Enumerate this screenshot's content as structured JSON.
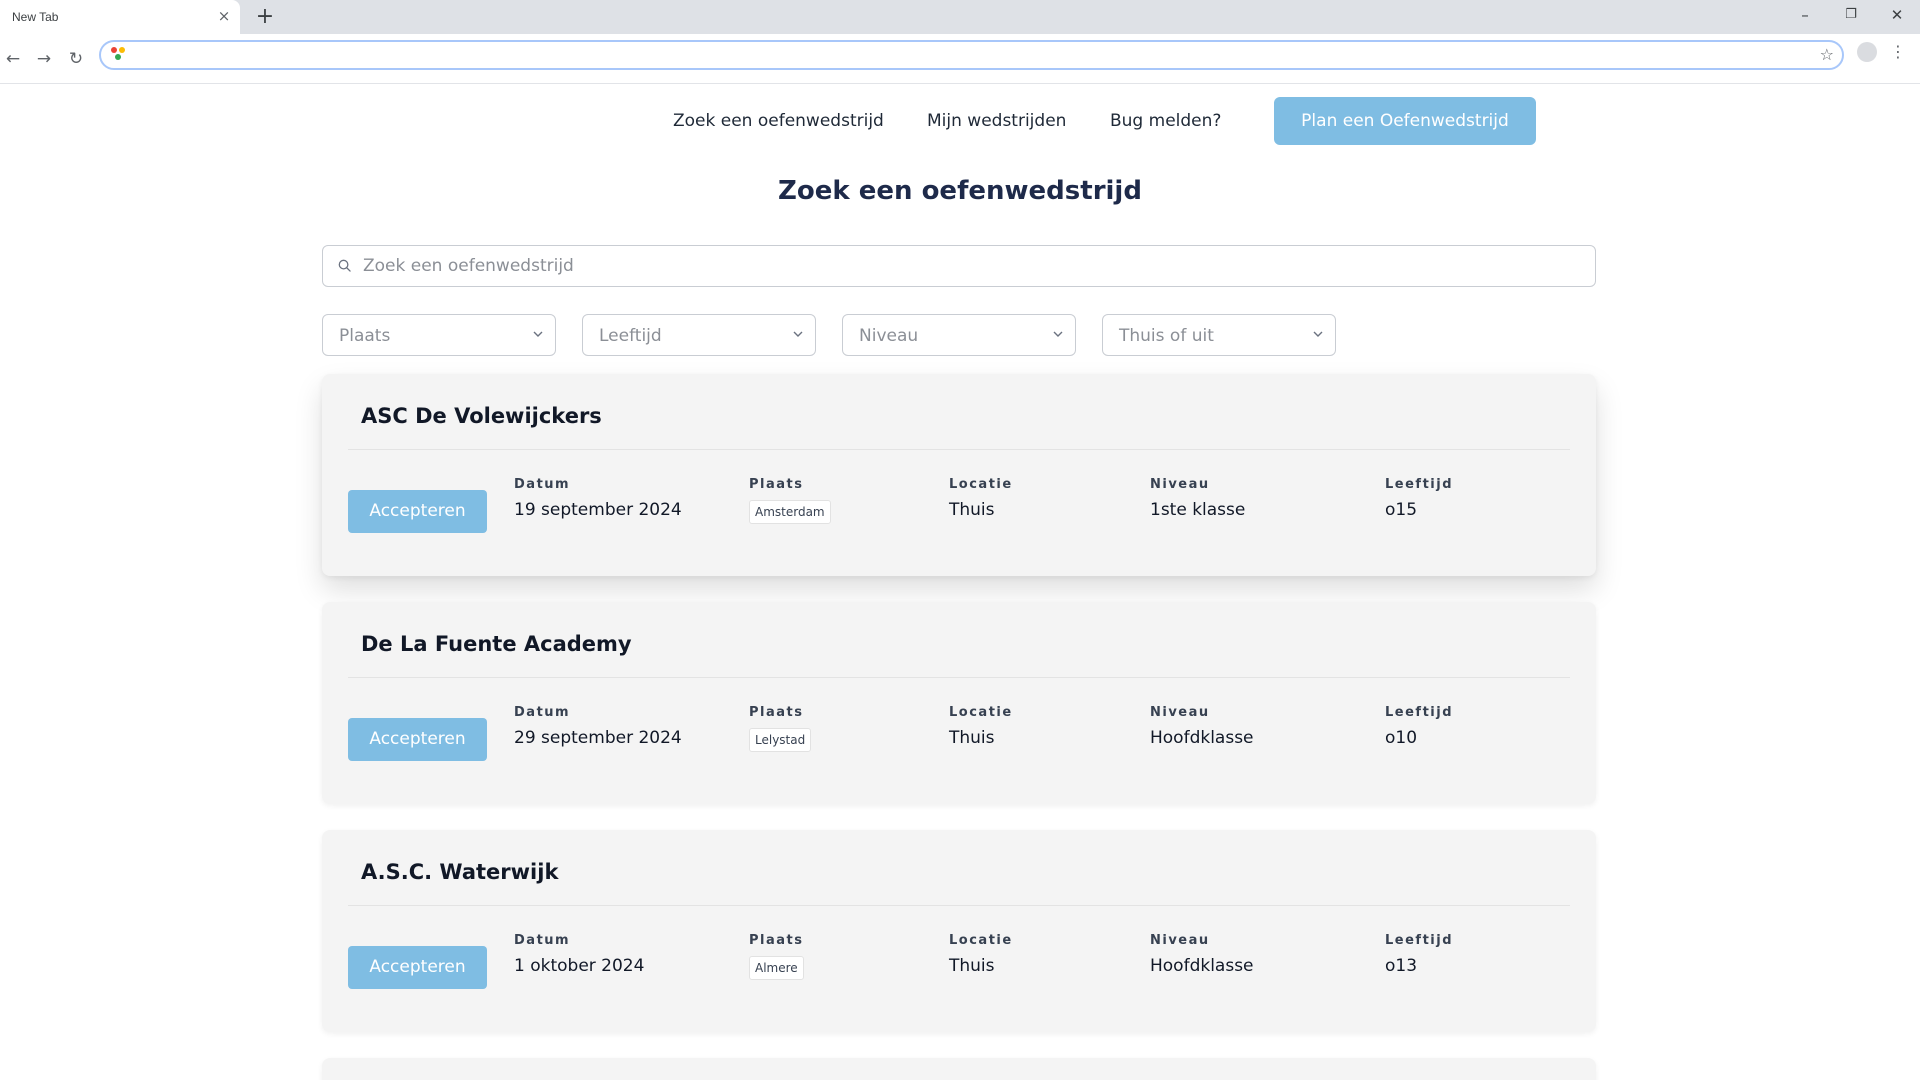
{
  "browser": {
    "tab_title": "New Tab",
    "tab_close": "×",
    "new_tab": "+",
    "minimize": "–",
    "restore": "❐",
    "close": "✕",
    "back": "←",
    "forward": "→",
    "reload": "↻",
    "url": "",
    "star": "☆",
    "menu": "⋮"
  },
  "nav": {
    "links": [
      "Zoek een oefenwedstrijd",
      "Mijn wedstrijden",
      "Bug melden?"
    ],
    "plan_button": "Plan een Oefenwedstrijd"
  },
  "page_title": "Zoek een oefenwedstrijd",
  "search": {
    "placeholder": "Zoek een oefenwedstrijd",
    "icon": "search-icon"
  },
  "filters": [
    "Plaats",
    "Leeftijd",
    "Niveau",
    "Thuis of uit"
  ],
  "labels": {
    "datum": "Datum",
    "plaats": "Plaats",
    "locatie": "Locatie",
    "niveau": "Niveau",
    "leeftijd": "Leeftijd",
    "accept": "Accepteren"
  },
  "matches": [
    {
      "club": "ASC De Volewijckers",
      "datum": "19 september 2024",
      "plaats": "Amsterdam",
      "locatie": "Thuis",
      "niveau": "1ste klasse",
      "leeftijd": "o15"
    },
    {
      "club": "De La Fuente Academy",
      "datum": "29 september 2024",
      "plaats": "Lelystad",
      "locatie": "Thuis",
      "niveau": "Hoofdklasse",
      "leeftijd": "o10"
    },
    {
      "club": "A.S.C. Waterwijk",
      "datum": "1 oktober 2024",
      "plaats": "Almere",
      "locatie": "Thuis",
      "niveau": "Hoofdklasse",
      "leeftijd": "o13"
    }
  ],
  "colors": {
    "accent": "#7fbde3",
    "card_bg": "#f4f4f4",
    "title": "#1e2a4a"
  }
}
